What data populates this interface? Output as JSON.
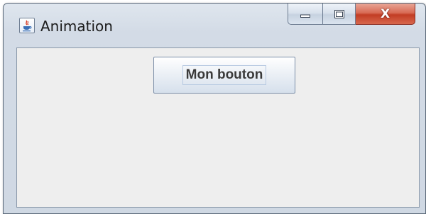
{
  "window": {
    "title": "Animation",
    "app_icon": "java-cup-icon",
    "caption_buttons": {
      "minimize_icon": "minimize-icon",
      "maximize_icon": "maximize-icon",
      "close_label": "X"
    }
  },
  "content": {
    "button_label": "Mon bouton"
  },
  "colors": {
    "client_background": "#eeeeee",
    "close_button": "#c94a33",
    "button_text": "#3a3a3a"
  }
}
